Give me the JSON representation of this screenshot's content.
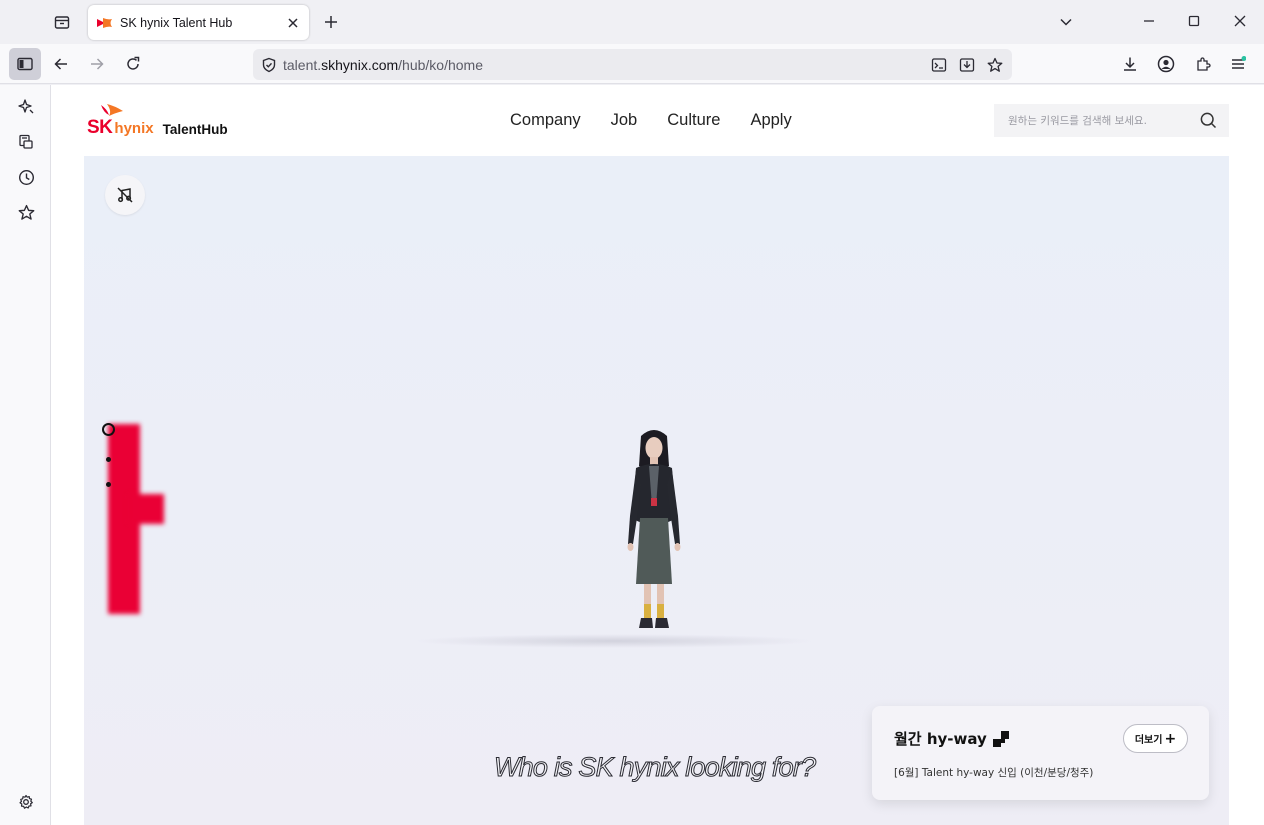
{
  "browser": {
    "tab_title": "SK hynix Talent Hub",
    "url_prefix": "talent.",
    "url_host": "skhynix.com",
    "url_path": "/hub/ko/home"
  },
  "site": {
    "logo_sk": "SK",
    "logo_hynix": "hynix",
    "logo_talenthub": "TalentHub",
    "nav": [
      {
        "label": "Company"
      },
      {
        "label": "Job"
      },
      {
        "label": "Culture"
      },
      {
        "label": "Apply"
      }
    ],
    "search_placeholder": "원하는 키워드를 검색해 보세요."
  },
  "hero": {
    "tagline": "Who is SK hynix looking for?"
  },
  "card": {
    "title": "월간 hy-way",
    "subtitle": "[6월] Talent hy-way 신입 (이천/분당/청주)",
    "more_label": "더보기"
  },
  "colors": {
    "brand_red": "#ea002c",
    "brand_orange": "#f47725"
  }
}
